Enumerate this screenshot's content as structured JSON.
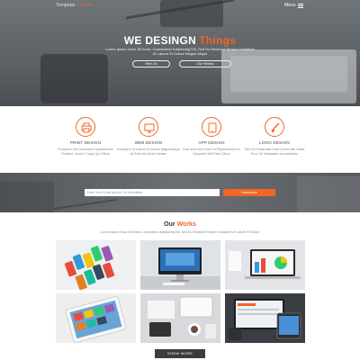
{
  "header": {
    "brand": "Template",
    "brand_accent": "Theme",
    "menu_label": "Menu"
  },
  "hero": {
    "title": "WE DESINGN",
    "title_accent": "Things",
    "subtitle": "Lorem Ipsum Dolor Sit Amet, Consectetur Adipisicing Elit, Sed Do Eiusmod Tempor Incididunt Ut Labore Et Dolore Magna Aliqua",
    "btn_hire": "Hire Us",
    "btn_works": "Our Works"
  },
  "services": [
    {
      "icon": "print-icon",
      "title": "PRINT DESIGN",
      "text": "Excepteur Sint Occaecat Cupidatat Non Proident, Sunt In Culpa Qui Officia"
    },
    {
      "icon": "web-design-icon",
      "title": "WEB DESIGN",
      "text": "Excepteur Ut Labore Et Dolore Magna Aliqua Ut Enim Ad Minim Veniam"
    },
    {
      "icon": "tablet-icon",
      "title": "APP DESIGN",
      "text": "Duis Aute Irure Dolor In Reprehenderit In Voluptate Velit Esse Cillum"
    },
    {
      "icon": "brush-icon",
      "title": "LOGO DESIGN",
      "text": "Sed Ut Perspiciatis Unde Omnis Iste Natus Error Sit Voluptatem Accusantium"
    }
  ],
  "subscribe": {
    "placeholder": "Enter Your Email Adress For Newsletter",
    "button": "Subscribe"
  },
  "works": {
    "title": "Our",
    "title_accent": "Works",
    "subtitle": "Lorem Ipsum Dolor Sit Amet, Consectetur Adipisicing Elit, Sed Do Eiusmod Tempor Incididunt Ut Labore Et Dolore",
    "show_more": "SHOW MORE"
  },
  "colors": {
    "accent": "#f26522",
    "hero_bg": "#5c6166",
    "dark_button": "#3c3c3c"
  }
}
